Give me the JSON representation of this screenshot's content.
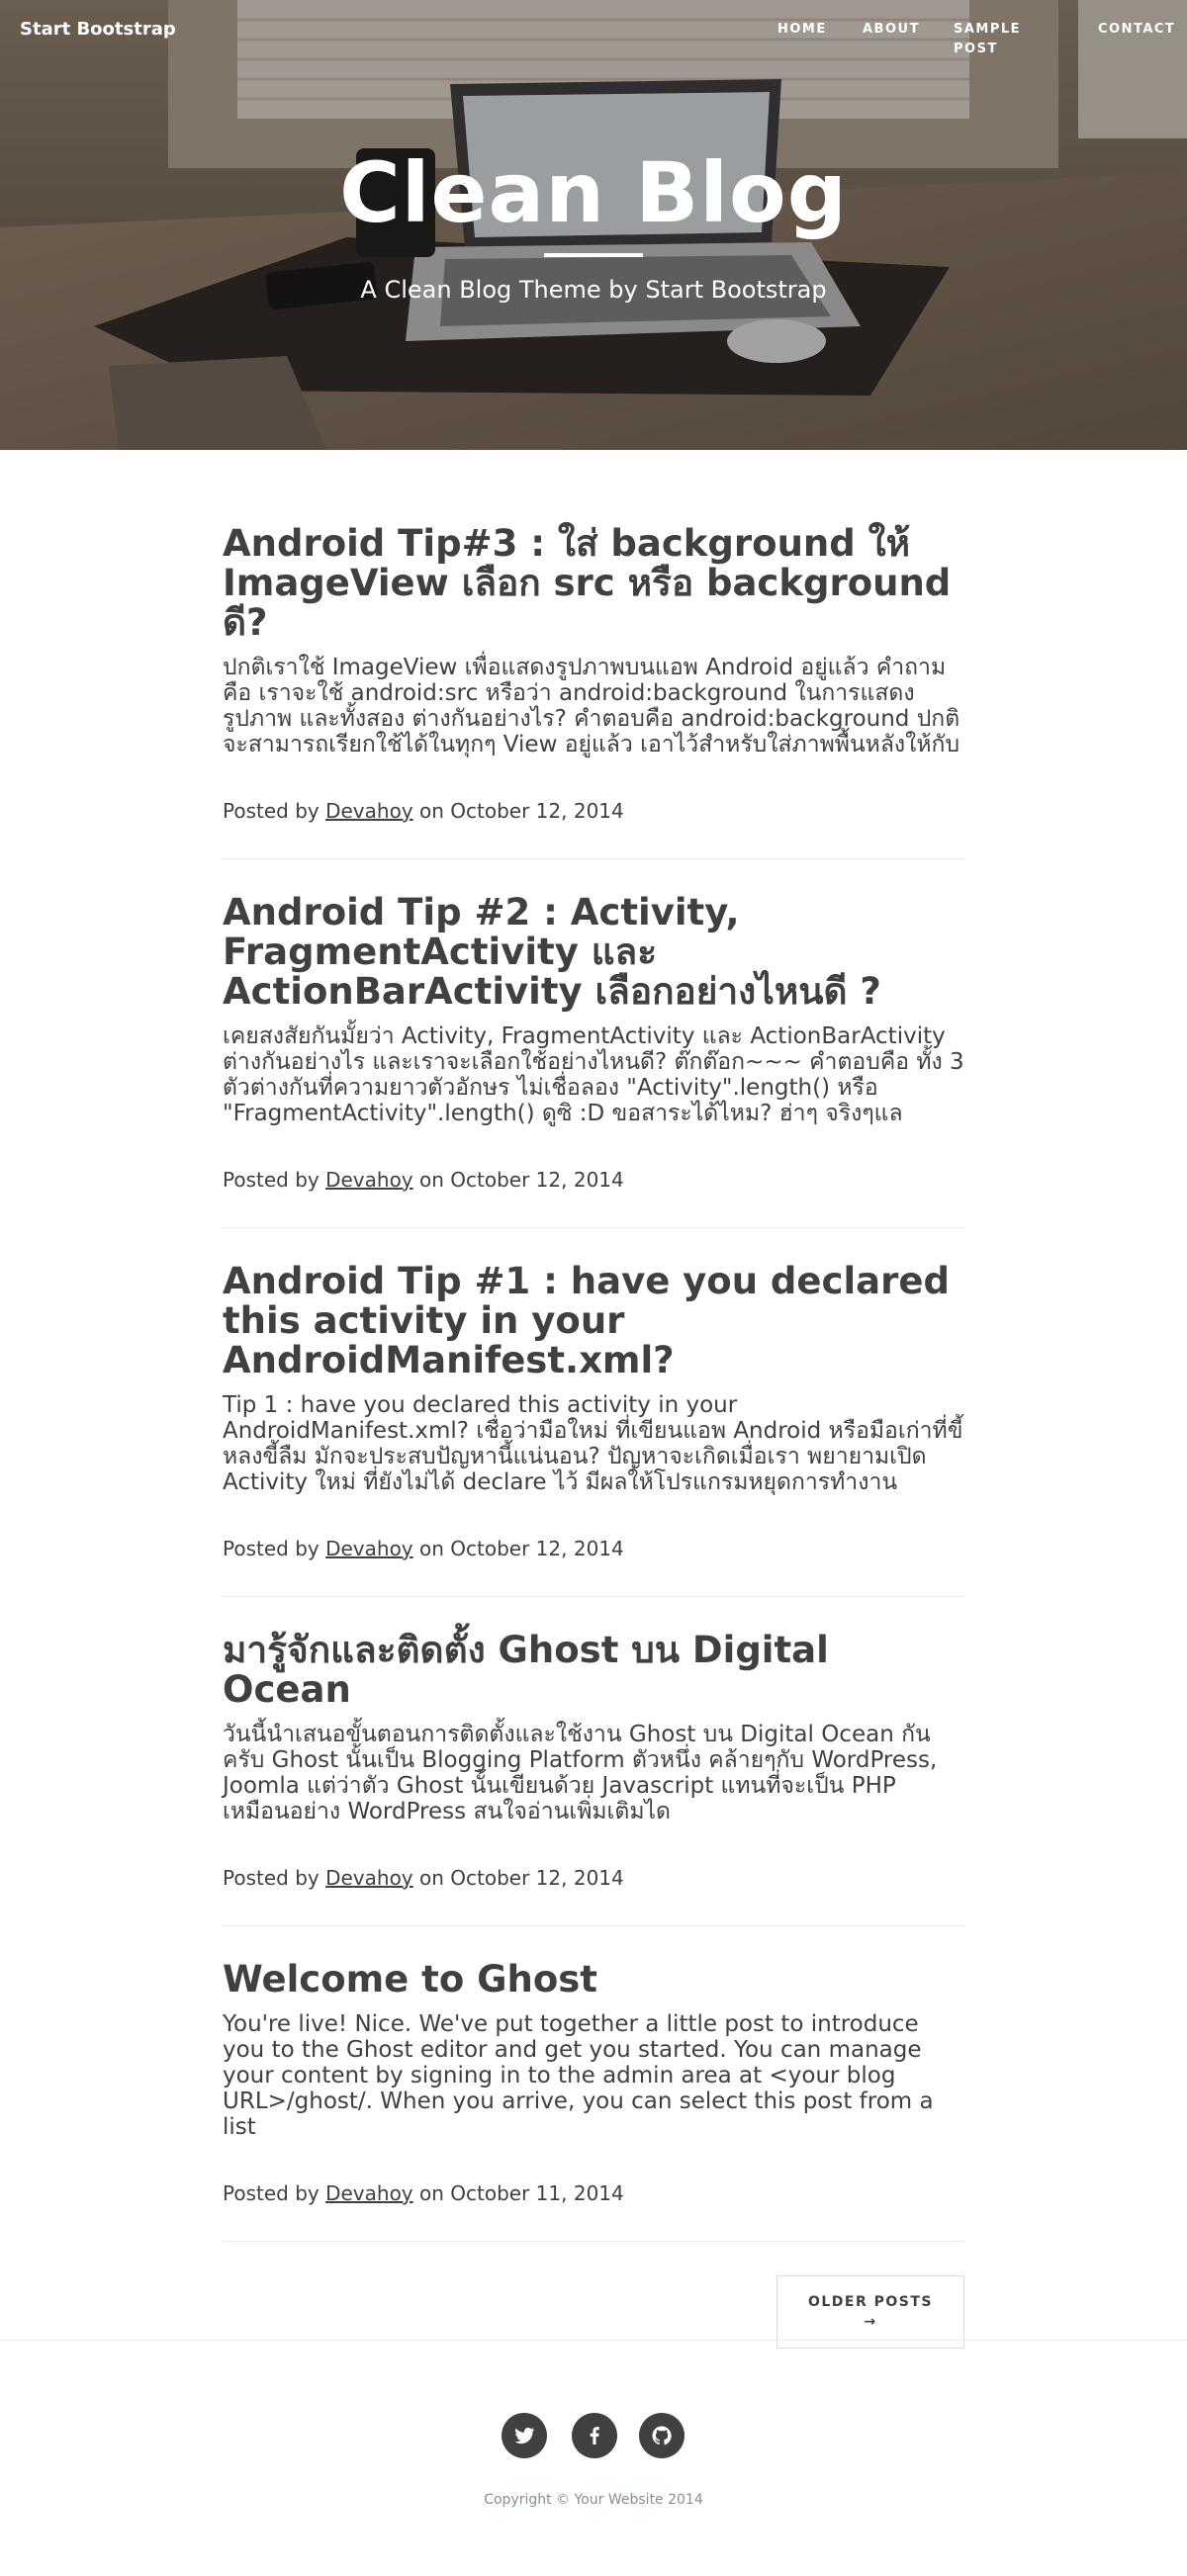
{
  "header": {
    "brand": "Start Bootstrap",
    "nav": [
      "HOME",
      "ABOUT",
      "SAMPLE POST",
      "CONTACT"
    ],
    "title": "Clean Blog",
    "subtitle": "A Clean Blog Theme by Start Bootstrap"
  },
  "posts": [
    {
      "title": "Android Tip#3 : ใส่ background ให้ ImageView เลือก src หรือ background ดี?",
      "excerpt": "ปกติเราใช้ ImageView เพื่อแสดงรูปภาพบนแอพ Android อยู่แล้ว คำถามคือ เราจะใช้ android:src หรือว่า android:background ในการแสดงรูปภาพ และทั้งสอง ต่างกันอย่างไร? คำตอบคือ android:background ปกติ จะสามารถเรียกใช้ได้ในทุกๆ View อยู่แล้ว เอาไว้สำหรับใส่ภาพพื้นหลังให้กับ",
      "posted_by": "Posted by",
      "author": "Devahoy",
      "on": "on",
      "date": "October 12, 2014"
    },
    {
      "title": "Android Tip #2 : Activity, FragmentActivity และ ActionBarActivity เลือกอย่างไหนดี ?",
      "excerpt": "เคยสงสัยกันมั้ยว่า Activity, FragmentActivity และ ActionBarActivity ต่างกันอย่างไร และเราจะเลือกใช้อย่างไหนดี? ต๊กต๊อก~~~ คำตอบคือ ทั้ง 3 ตัวต่างกันที่ความยาวตัวอักษร ไม่เชื่อลอง \"Activity\".length() หรือ \"FragmentActivity\".length() ดูซิ :D ขอสาระได้ไหม? ฮ่าๆ จริงๆแล",
      "posted_by": "Posted by",
      "author": "Devahoy",
      "on": "on",
      "date": "October 12, 2014"
    },
    {
      "title": "Android Tip #1 : have you declared this activity in your AndroidManifest.xml?",
      "excerpt": "Tip 1 : have you declared this activity in your AndroidManifest.xml? เชื่อว่ามือใหม่ ที่เขียนแอพ Android หรือมือเก่าที่ขี้หลงขี้ลืม มักจะประสบปัญหานี้แน่นอน? ปัญหาจะเกิดเมื่อเรา พยายามเปิด Activity ใหม่ ที่ยังไม่ได้ declare ไว้ มีผลให้โปรแกรมหยุดการทำงาน",
      "posted_by": "Posted by",
      "author": "Devahoy",
      "on": "on",
      "date": "October 12, 2014"
    },
    {
      "title": "มารู้จักและติดตั้ง Ghost บน Digital Ocean",
      "excerpt": "วันนี้นำเสนอขั้นตอนการติดตั้งและใช้งาน Ghost บน Digital Ocean กันครับ Ghost นั้นเป็น Blogging Platform ตัวหนึ่ง คล้ายๆกับ WordPress, Joomla แต่ว่าตัว Ghost นั้นเขียนด้วย Javascript แทนที่จะเป็น PHP เหมือนอย่าง WordPress สนใจอ่านเพิ่มเติมได",
      "posted_by": "Posted by",
      "author": "Devahoy",
      "on": "on",
      "date": "October 12, 2014"
    },
    {
      "title": "Welcome to Ghost",
      "excerpt": "You're live! Nice. We've put together a little post to introduce you to the Ghost editor and get you started. You can manage your content by signing in to the admin area at <your blog URL>/ghost/. When you arrive, you can select this post from a list",
      "posted_by": "Posted by",
      "author": "Devahoy",
      "on": "on",
      "date": "October 11, 2014"
    }
  ],
  "pager": {
    "older_label": "OLDER POSTS",
    "arrow": "→"
  },
  "footer": {
    "social": [
      "twitter-icon",
      "facebook-icon",
      "github-icon"
    ],
    "copyright": "Copyright © Your Website 2014"
  }
}
